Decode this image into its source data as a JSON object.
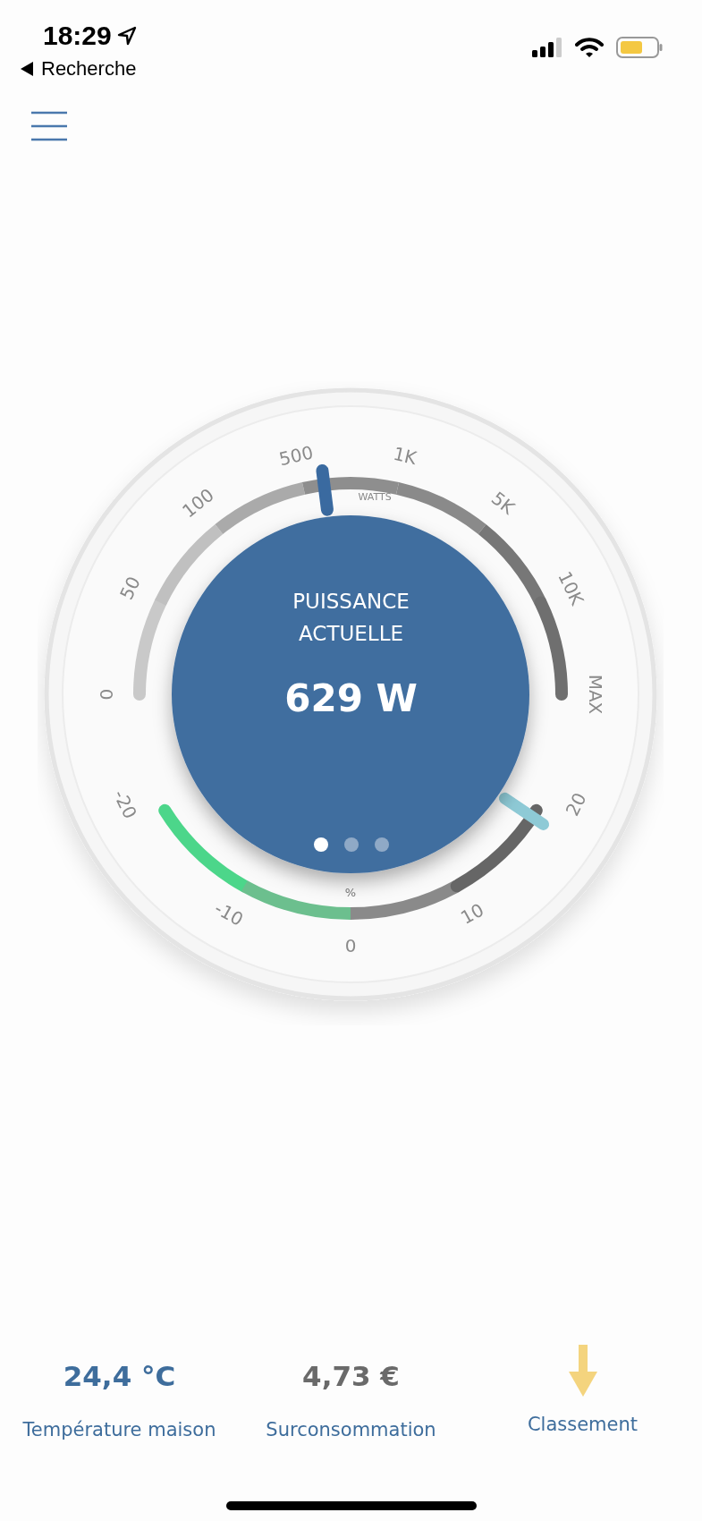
{
  "status_bar": {
    "time": "18:29",
    "back_label": "Recherche"
  },
  "gauge": {
    "title": "PUISSANCE ACTUELLE",
    "reading": "629 W",
    "unit_label": "WATTS",
    "power_scale": {
      "ticks": [
        "0",
        "50",
        "100",
        "500",
        "1K",
        "5K",
        "10K",
        "MAX"
      ],
      "level": 0.46
    },
    "percent_scale": {
      "label": "%",
      "ticks": [
        "-20",
        "-10",
        "0",
        "10",
        "20"
      ],
      "level": 1.0
    },
    "pages": [
      {
        "selected": true
      },
      {
        "selected": false
      },
      {
        "selected": false
      }
    ]
  },
  "stats": [
    {
      "kind": "temperature",
      "value": "24,4 °C",
      "label": "Température maison"
    },
    {
      "kind": "cost",
      "value": "4,73 €",
      "label": "Surconsommation"
    },
    {
      "kind": "arrow",
      "label": "Classement"
    }
  ]
}
